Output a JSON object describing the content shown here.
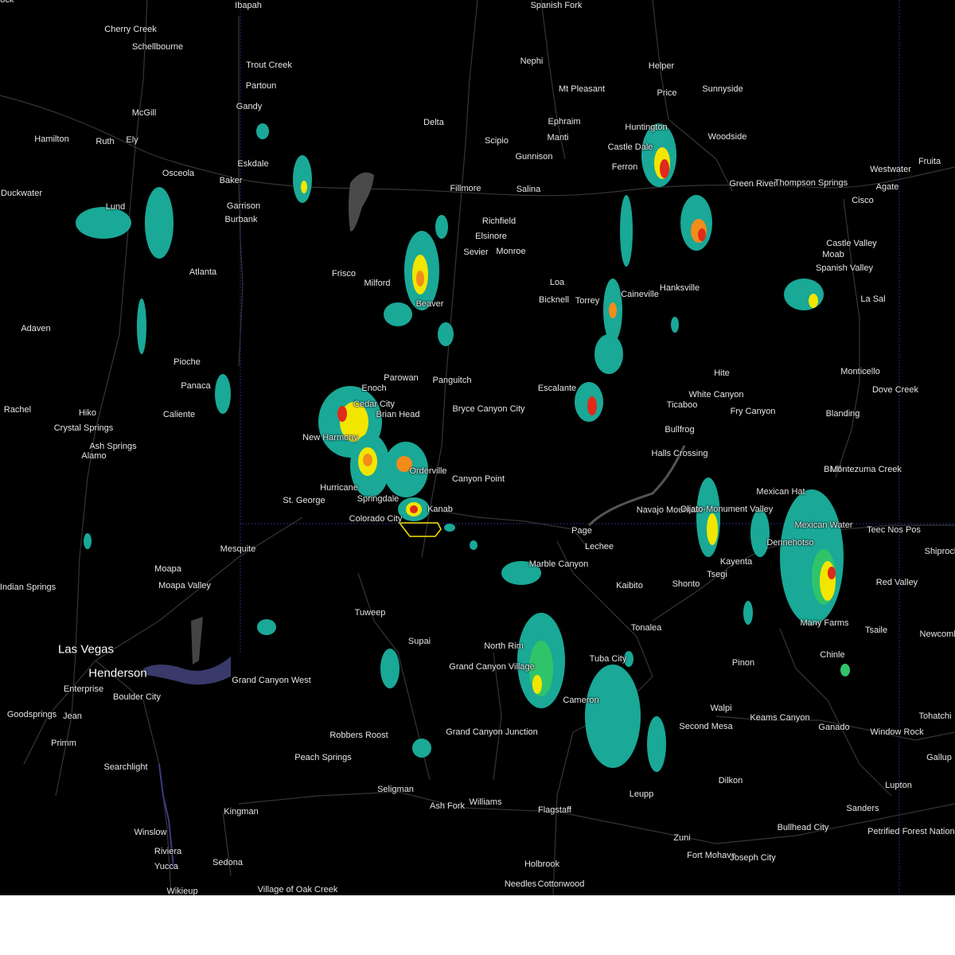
{
  "map": {
    "colors": {
      "background": "#000000",
      "roads": "#3a3a3a",
      "state_line": "#2a2aa0",
      "warning_polygon": "#f2e600",
      "radar_light": "#1aa897",
      "radar_mid": "#2fc46a",
      "radar_yellow": "#f2e600",
      "radar_orange": "#f28c1a",
      "radar_red": "#e02a1a"
    },
    "places": [
      {
        "name": "Ibapah"
      },
      {
        "name": "Spanish Fork"
      },
      {
        "name": "Cherry Creek"
      },
      {
        "name": "Schellbourne"
      },
      {
        "name": "Trout Creek"
      },
      {
        "name": "Partoun"
      },
      {
        "name": "Nephi"
      },
      {
        "name": "Helper"
      },
      {
        "name": "Mt Pleasant"
      },
      {
        "name": "Price"
      },
      {
        "name": "Sunnyside"
      },
      {
        "name": "McGill"
      },
      {
        "name": "Gandy"
      },
      {
        "name": "Delta"
      },
      {
        "name": "Ephraim"
      },
      {
        "name": "Hamilton"
      },
      {
        "name": "Ruth"
      },
      {
        "name": "Ely"
      },
      {
        "name": "Manti"
      },
      {
        "name": "Huntington"
      },
      {
        "name": "Scipio"
      },
      {
        "name": "Woodside"
      },
      {
        "name": "Castle Dale"
      },
      {
        "name": "Gunnison"
      },
      {
        "name": "Eskdale"
      },
      {
        "name": "Osceola"
      },
      {
        "name": "Ferron"
      },
      {
        "name": "Baker"
      },
      {
        "name": "Westwater"
      },
      {
        "name": "Fruita"
      },
      {
        "name": "Green River"
      },
      {
        "name": "Thompson Springs"
      },
      {
        "name": "Duckwater"
      },
      {
        "name": "Fillmore"
      },
      {
        "name": "Salina"
      },
      {
        "name": "Agate"
      },
      {
        "name": "Garrison"
      },
      {
        "name": "Cisco"
      },
      {
        "name": "Lund"
      },
      {
        "name": "Burbank"
      },
      {
        "name": "Richfield"
      },
      {
        "name": "Elsinore"
      },
      {
        "name": "Sevier"
      },
      {
        "name": "Monroe"
      },
      {
        "name": "Castle Valley"
      },
      {
        "name": "Moab"
      },
      {
        "name": "Spanish Valley"
      },
      {
        "name": "Atlanta"
      },
      {
        "name": "Frisco"
      },
      {
        "name": "Milford"
      },
      {
        "name": "Loa"
      },
      {
        "name": "Caineville"
      },
      {
        "name": "Hanksville"
      },
      {
        "name": "Bicknell"
      },
      {
        "name": "Torrey"
      },
      {
        "name": "La Sal"
      },
      {
        "name": "Beaver"
      },
      {
        "name": "Adaven"
      },
      {
        "name": "Pioche"
      },
      {
        "name": "Parowan"
      },
      {
        "name": "Panguitch"
      },
      {
        "name": "Hite"
      },
      {
        "name": "Monticello"
      },
      {
        "name": "Panaca"
      },
      {
        "name": "Escalante"
      },
      {
        "name": "White Canyon"
      },
      {
        "name": "Dove Creek"
      },
      {
        "name": "Enoch"
      },
      {
        "name": "Rachel"
      },
      {
        "name": "Cedar City"
      },
      {
        "name": "Bryce Canyon City"
      },
      {
        "name": "Ticaboo"
      },
      {
        "name": "Fry Canyon"
      },
      {
        "name": "Hiko"
      },
      {
        "name": "Caliente"
      },
      {
        "name": "Brian Head"
      },
      {
        "name": "Blanding"
      },
      {
        "name": "Crystal Springs"
      },
      {
        "name": "Bullfrog"
      },
      {
        "name": "New Harmony"
      },
      {
        "name": "Ash Springs"
      },
      {
        "name": "Alamo"
      },
      {
        "name": "Halls Crossing"
      },
      {
        "name": "Orderville"
      },
      {
        "name": "Bluff"
      },
      {
        "name": "Montezuma Creek"
      },
      {
        "name": "Canyon Point"
      },
      {
        "name": "Hurricane"
      },
      {
        "name": "Mexican Hat"
      },
      {
        "name": "St. George"
      },
      {
        "name": "Springdale"
      },
      {
        "name": "Kanab"
      },
      {
        "name": "Navajo Mountain"
      },
      {
        "name": "Oljato-Monument Valley"
      },
      {
        "name": "Colorado City"
      },
      {
        "name": "Mexican Water"
      },
      {
        "name": "Teec Nos Pos"
      },
      {
        "name": "Page"
      },
      {
        "name": "Dennehotso"
      },
      {
        "name": "Shiprock"
      },
      {
        "name": "Mesquite"
      },
      {
        "name": "Lechee"
      },
      {
        "name": "Kayenta"
      },
      {
        "name": "Marble Canyon"
      },
      {
        "name": "Moapa"
      },
      {
        "name": "Tsegi"
      },
      {
        "name": "Red Valley"
      },
      {
        "name": "Indian Springs"
      },
      {
        "name": "Moapa Valley"
      },
      {
        "name": "Kaibito"
      },
      {
        "name": "Shonto"
      },
      {
        "name": "Tuweep"
      },
      {
        "name": "Many Farms"
      },
      {
        "name": "Tonalea"
      },
      {
        "name": "Tsaile"
      },
      {
        "name": "Newcomb"
      },
      {
        "name": "Supai"
      },
      {
        "name": "Las Vegas"
      },
      {
        "name": "North Rim"
      },
      {
        "name": "Chinle"
      },
      {
        "name": "Grand Canyon Village"
      },
      {
        "name": "Tuba City"
      },
      {
        "name": "Pinon"
      },
      {
        "name": "Henderson"
      },
      {
        "name": "Enterprise"
      },
      {
        "name": "Grand Canyon West"
      },
      {
        "name": "Boulder City"
      },
      {
        "name": "Cameron"
      },
      {
        "name": "Goodsprings"
      },
      {
        "name": "Jean"
      },
      {
        "name": "Walpi"
      },
      {
        "name": "Tohatchi"
      },
      {
        "name": "Keams Canyon"
      },
      {
        "name": "Second Mesa"
      },
      {
        "name": "Ganado"
      },
      {
        "name": "Primm"
      },
      {
        "name": "Grand Canyon Junction"
      },
      {
        "name": "Robbers Roost"
      },
      {
        "name": "Window Rock"
      },
      {
        "name": "Searchlight"
      },
      {
        "name": "Peach Springs"
      },
      {
        "name": "Gallup"
      },
      {
        "name": "Dilkon"
      },
      {
        "name": "Leupp"
      },
      {
        "name": "Seligman"
      },
      {
        "name": "Lupton"
      },
      {
        "name": "Ash Fork"
      },
      {
        "name": "Williams"
      },
      {
        "name": "Kingman"
      },
      {
        "name": "Sanders"
      },
      {
        "name": "Flagstaff"
      },
      {
        "name": "Bullhead City"
      },
      {
        "name": "Petrified Forest National Park"
      },
      {
        "name": "Zuni"
      },
      {
        "name": "Winslow"
      },
      {
        "name": "Riviera"
      },
      {
        "name": "Fort Mohave"
      },
      {
        "name": "Joseph City"
      },
      {
        "name": "Holbrook"
      },
      {
        "name": "Sedona"
      },
      {
        "name": "Yucca"
      },
      {
        "name": "Needles"
      },
      {
        "name": "Cottonwood"
      },
      {
        "name": "Village of Oak Creek"
      },
      {
        "name": "Wikieup"
      },
      {
        "name": "Topock"
      }
    ]
  }
}
